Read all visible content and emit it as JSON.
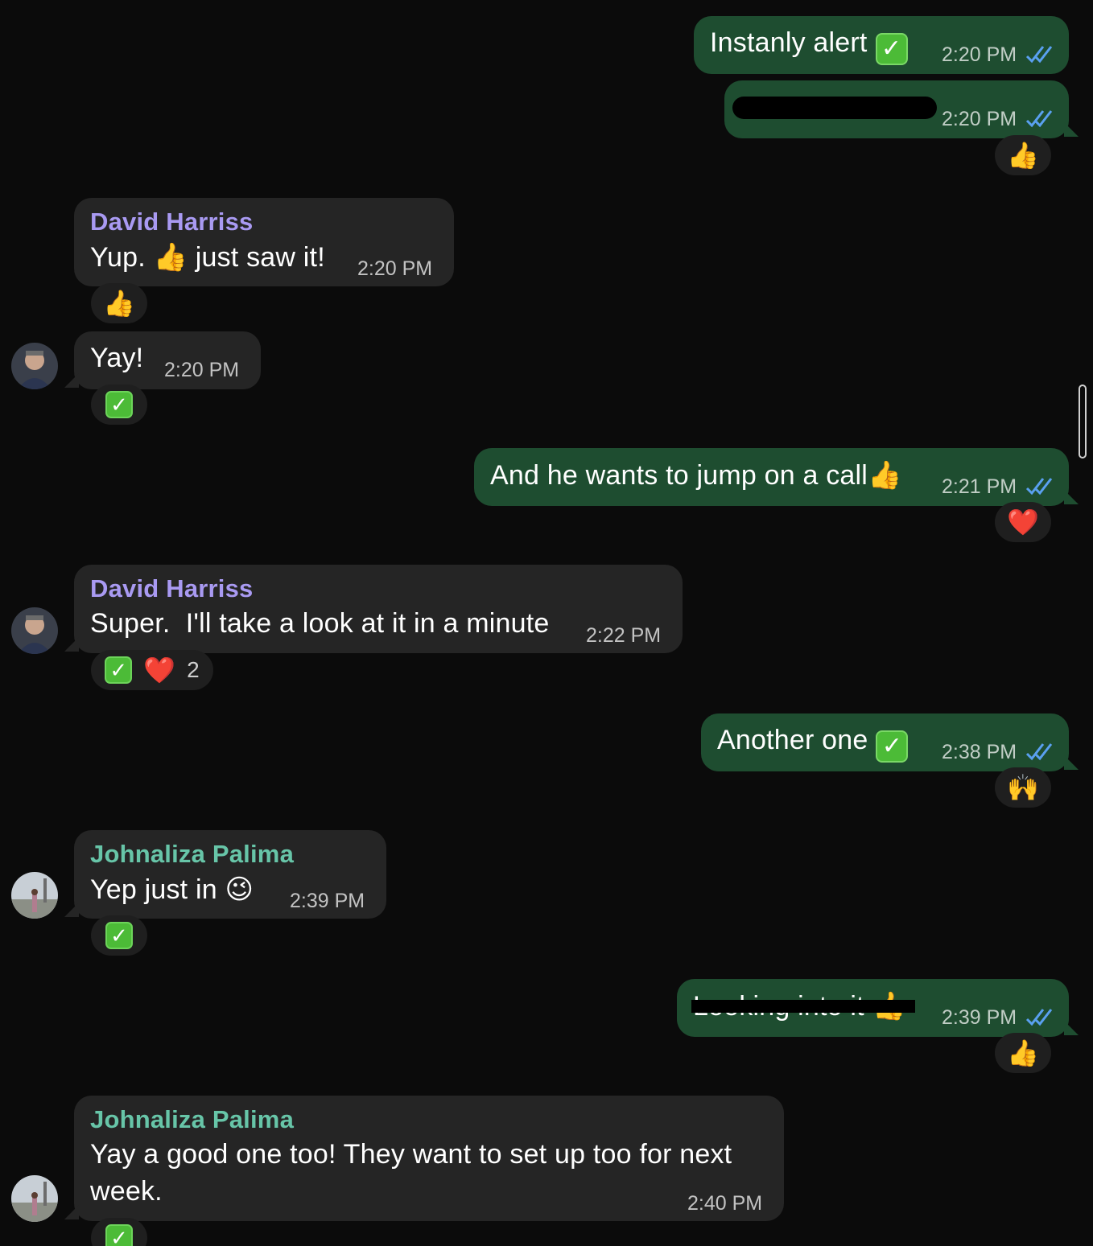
{
  "colors": {
    "outgoing_bubble": "#1e4d30",
    "incoming_bubble": "#252525",
    "background": "#0b0b0b",
    "read_ticks": "#5aa0f0",
    "sender_david": "#a99af2",
    "sender_johnaliza": "#67c5a8"
  },
  "messages": [
    {
      "direction": "out",
      "text": "Instanly alert",
      "inline_emoji": "check-mark-button",
      "time": "2:20 PM",
      "status": "read"
    },
    {
      "direction": "out",
      "text": "",
      "redacted": true,
      "time": "2:20 PM",
      "status": "read",
      "reaction": {
        "emoji": "👍"
      }
    },
    {
      "direction": "in",
      "sender": "David Harriss",
      "text_before": "Yup.",
      "inline_emoji": "👍",
      "text_after": "just saw it!",
      "time": "2:20 PM",
      "reaction": {
        "emoji": "👍"
      }
    },
    {
      "direction": "in",
      "text": "Yay!",
      "time": "2:20 PM",
      "reaction": {
        "emoji": "check-mark-button"
      }
    },
    {
      "direction": "out",
      "text": "And he wants to jump on a call",
      "inline_emoji": "👍",
      "time": "2:21 PM",
      "status": "read",
      "reaction": {
        "emoji": "❤️"
      }
    },
    {
      "direction": "in",
      "sender": "David Harriss",
      "text": "Super.  I'll take a look at it in a minute",
      "time": "2:22 PM",
      "reaction": {
        "emoji": "check-mark-button",
        "emoji2": "❤️",
        "count": "2"
      }
    },
    {
      "direction": "out",
      "text": "Another one",
      "inline_emoji": "check-mark-button",
      "time": "2:38 PM",
      "status": "read",
      "reaction": {
        "emoji": "🙌"
      }
    },
    {
      "direction": "in",
      "sender": "Johnaliza Palima",
      "text": "Yep just in",
      "inline_emoji": "😉",
      "time": "2:39 PM",
      "reaction": {
        "emoji": "check-mark-button"
      }
    },
    {
      "direction": "out",
      "text": "Looking into it",
      "inline_emoji": "👍",
      "redacted": true,
      "time": "2:39 PM",
      "status": "read",
      "reaction": {
        "emoji": "👍"
      }
    },
    {
      "direction": "in",
      "sender": "Johnaliza Palima",
      "text_line1": "Yay a good one too! They want to set up too for next",
      "text_line2": "week.",
      "time": "2:40 PM",
      "reaction": {
        "emoji": "check-mark-button"
      }
    }
  ]
}
